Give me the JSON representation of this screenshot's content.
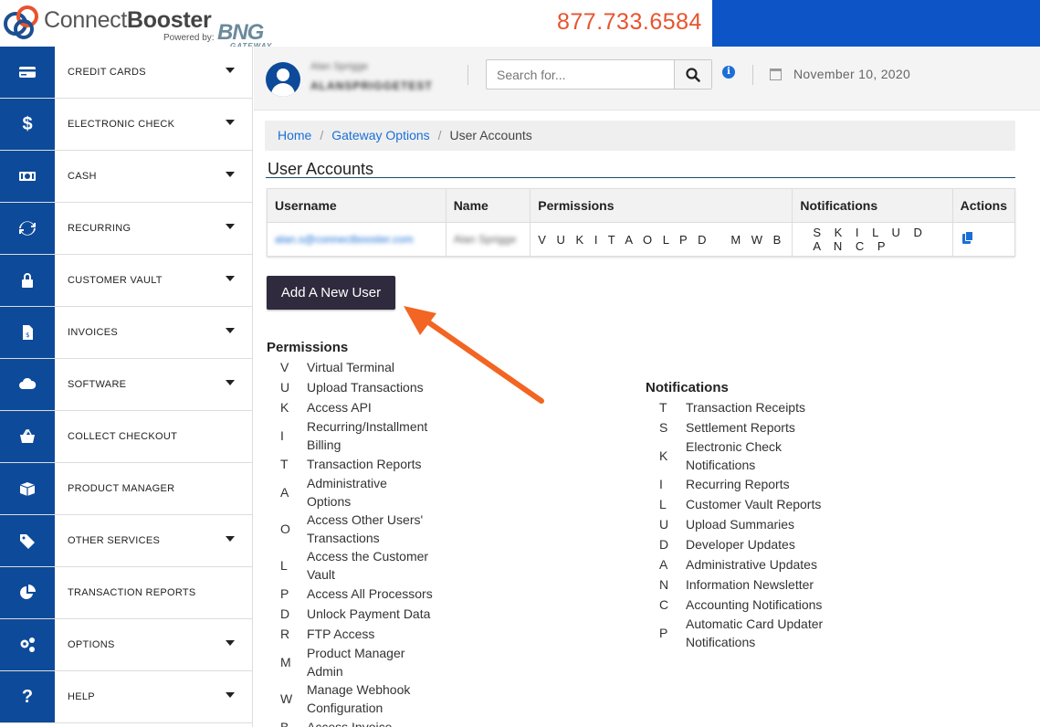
{
  "header": {
    "logo_connect": "Connect",
    "logo_booster": "Booster",
    "logo_powered": "Powered by:",
    "logo_bng": "BNG",
    "logo_gateway": "GATEWAY",
    "phone": "877.733.6584",
    "accent_color": "#e8532d",
    "bar_color": "#0d55c6"
  },
  "sidebar": {
    "icon_bg": "#0d4a99",
    "items": [
      {
        "label": "CREDIT CARDS",
        "icon": "credit-card-icon",
        "has_caret": true
      },
      {
        "label": "ELECTRONIC CHECK",
        "icon": "dollar-icon",
        "has_caret": true
      },
      {
        "label": "CASH",
        "icon": "cash-icon",
        "has_caret": true
      },
      {
        "label": "RECURRING",
        "icon": "refresh-icon",
        "has_caret": true
      },
      {
        "label": "CUSTOMER VAULT",
        "icon": "lock-icon",
        "has_caret": true
      },
      {
        "label": "INVOICES",
        "icon": "invoice-icon",
        "has_caret": true
      },
      {
        "label": "SOFTWARE",
        "icon": "cloud-icon",
        "has_caret": true
      },
      {
        "label": "COLLECT CHECKOUT",
        "icon": "basket-icon",
        "has_caret": false
      },
      {
        "label": "PRODUCT MANAGER",
        "icon": "box-icon",
        "has_caret": false
      },
      {
        "label": "OTHER SERVICES",
        "icon": "tags-icon",
        "has_caret": true
      },
      {
        "label": "TRANSACTION REPORTS",
        "icon": "pie-chart-icon",
        "has_caret": false
      },
      {
        "label": "OPTIONS",
        "icon": "gears-icon",
        "has_caret": true
      },
      {
        "label": "HELP",
        "icon": "question-icon",
        "has_caret": true
      }
    ]
  },
  "userbar": {
    "user_name": "Alan Sprigge",
    "user_id": "ALANSPRIGGETEST",
    "search_placeholder": "Search for...",
    "date": "November 10, 2020"
  },
  "breadcrumb": {
    "home": "Home",
    "gateway_options": "Gateway Options",
    "current": "User Accounts"
  },
  "page": {
    "title": "User Accounts",
    "add_button": "Add A New User"
  },
  "table": {
    "columns": [
      "Username",
      "Name",
      "Permissions",
      "Notifications",
      "Actions"
    ],
    "rows": [
      {
        "username": "alan.s@connectbooster.com",
        "name": "Alan Sprigge",
        "permissions": "V U K I T A O L P D   M W B",
        "notifications": "S K I L U D A N C P"
      }
    ]
  },
  "permissions": {
    "title": "Permissions",
    "items": [
      {
        "key": "V",
        "label": "Virtual Terminal"
      },
      {
        "key": "U",
        "label": "Upload Transactions"
      },
      {
        "key": "K",
        "label": "Access API"
      },
      {
        "key": "I",
        "label": "Recurring/Installment Billing"
      },
      {
        "key": "T",
        "label": "Transaction Reports"
      },
      {
        "key": "A",
        "label": "Administrative Options"
      },
      {
        "key": "O",
        "label": "Access Other Users' Transactions"
      },
      {
        "key": "L",
        "label": "Access the Customer Vault"
      },
      {
        "key": "P",
        "label": "Access All Processors"
      },
      {
        "key": "D",
        "label": "Unlock Payment Data"
      },
      {
        "key": "R",
        "label": "FTP Access"
      },
      {
        "key": "M",
        "label": "Product Manager Admin"
      },
      {
        "key": "W",
        "label": "Manage Webhook Configuration"
      },
      {
        "key": "B",
        "label": "Access Invoice"
      }
    ]
  },
  "notifications": {
    "title": "Notifications",
    "items": [
      {
        "key": "T",
        "label": "Transaction Receipts"
      },
      {
        "key": "S",
        "label": "Settlement Reports"
      },
      {
        "key": "K",
        "label": "Electronic Check Notifications"
      },
      {
        "key": "I",
        "label": "Recurring Reports"
      },
      {
        "key": "L",
        "label": "Customer Vault Reports"
      },
      {
        "key": "U",
        "label": "Upload Summaries"
      },
      {
        "key": "D",
        "label": "Developer Updates"
      },
      {
        "key": "A",
        "label": "Administrative Updates"
      },
      {
        "key": "N",
        "label": "Information Newsletter"
      },
      {
        "key": "C",
        "label": "Accounting Notifications"
      },
      {
        "key": "P",
        "label": "Automatic Card Updater Notifications"
      }
    ]
  }
}
